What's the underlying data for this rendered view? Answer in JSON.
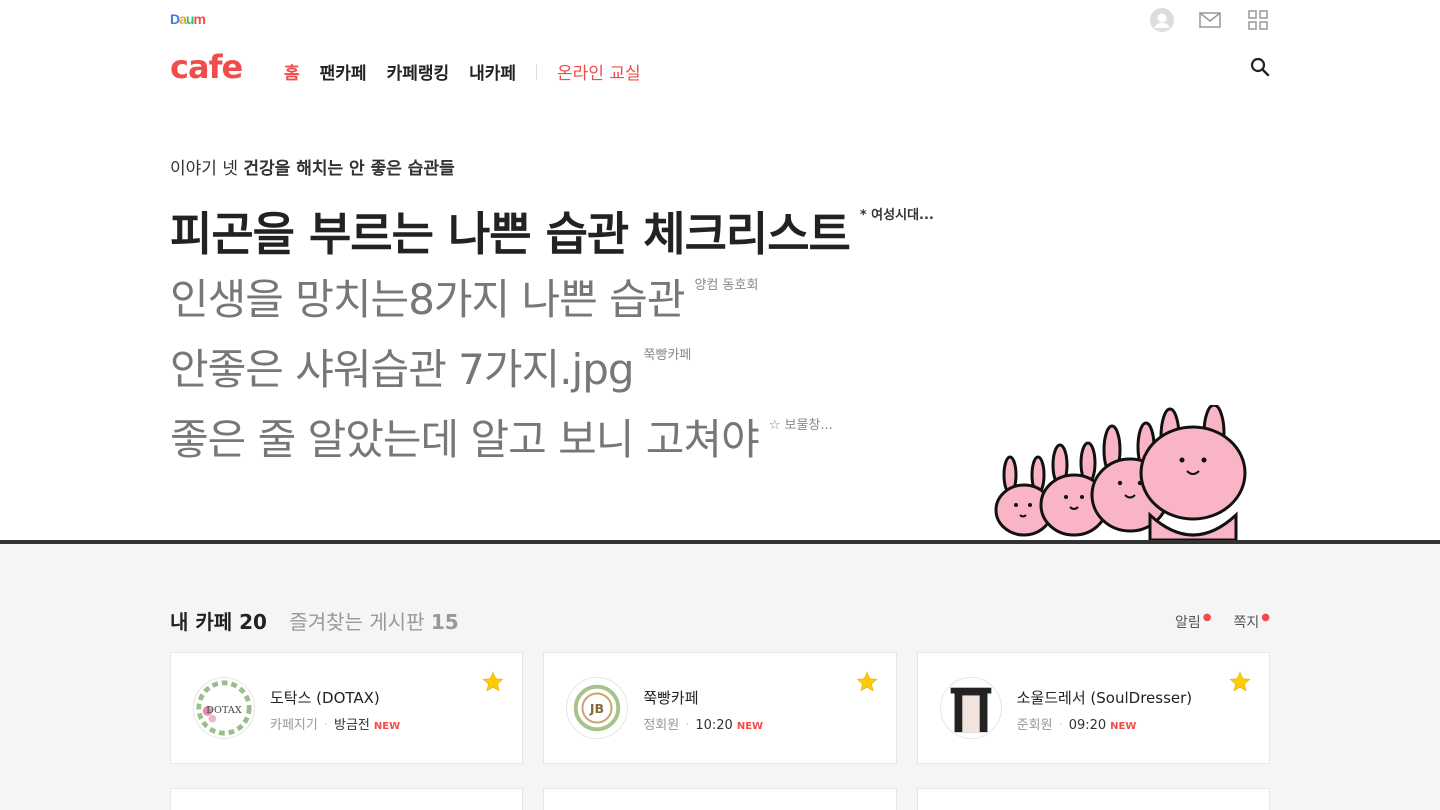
{
  "topbar": {
    "logo": "Daum",
    "icons": [
      "user-avatar-icon",
      "mail-icon",
      "apps-grid-icon"
    ]
  },
  "nav": {
    "logo": "cafe",
    "items": [
      {
        "label": "홈",
        "active": true
      },
      {
        "label": "팬카페"
      },
      {
        "label": "카페랭킹"
      },
      {
        "label": "내카페"
      }
    ],
    "online_label": "온라인 교실",
    "accent": "#f14c4c"
  },
  "hero": {
    "story_prefix": "이야기 넷",
    "story_title": "건강을 해치는 안 좋은 습관들",
    "headlines": [
      {
        "text": "피곤을 부르는 나쁜 습관 체크리스트",
        "source": "* 여성시대..."
      },
      {
        "text": "인생을 망치는8가지 나쁜 습관",
        "source": "양컴 동호회"
      },
      {
        "text": "안좋은 샤워습관 7가지.jpg",
        "source": "쭉빵카페"
      },
      {
        "text": "좋은 줄 알았는데 알고 보니 고쳐야",
        "source": "☆ 보물창..."
      }
    ]
  },
  "mycafe": {
    "title": "내 카페 20",
    "fav_label": "즐겨찾는 게시판",
    "fav_count": "15",
    "alert_label": "알림",
    "message_label": "쪽지",
    "cards": [
      {
        "name": "도탁스 (DOTAX)",
        "role": "카페지기",
        "time": "방금전",
        "new": "NEW",
        "thumb_text": "DOTAX"
      },
      {
        "name": "쭉빵카페",
        "role": "정회원",
        "time": "10:20",
        "new": "NEW",
        "thumb_text": "JB"
      },
      {
        "name": "소울드레서 (SoulDresser)",
        "role": "준회원",
        "time": "09:20",
        "new": "NEW",
        "thumb_text": ""
      }
    ]
  }
}
